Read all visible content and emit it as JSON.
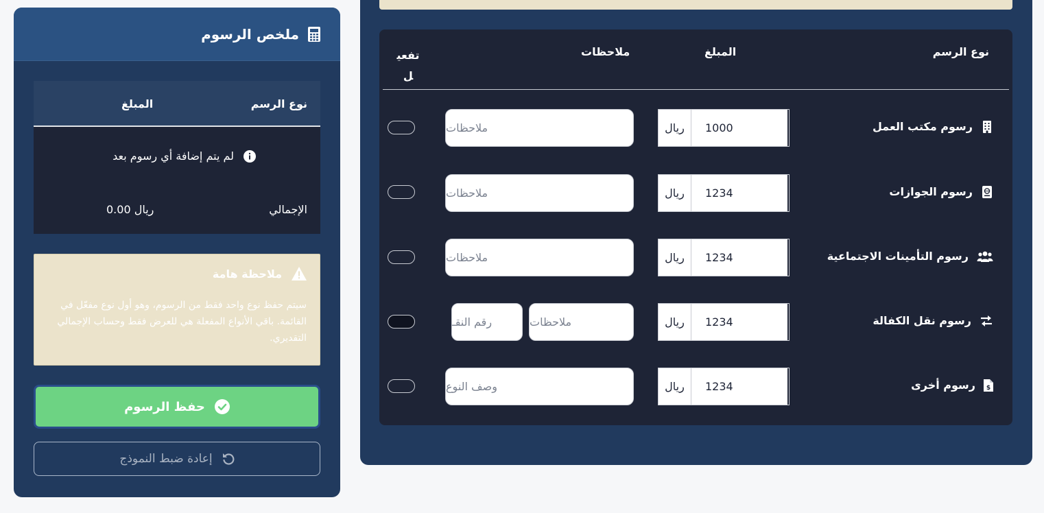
{
  "sidebar": {
    "title": "ملخص الرسوم",
    "summary": {
      "col_type": "نوع الرسم",
      "col_amount": "المبلغ",
      "empty_message": "لم يتم إضافة أي رسوم بعد",
      "total_label": "الإجمالي",
      "total_value": "0.00 ريال"
    },
    "note": {
      "title": "ملاحظة هامة",
      "body": "سيتم حفظ نوع واحد فقط من الرسوم، وهو أول نوع مفعّل في القائمة. باقي الأنواع المفعلة هي للعرض فقط وحساب الإجمالي التقديري."
    },
    "save_label": "حفظ الرسوم",
    "reset_label": "إعادة ضبط النموذج"
  },
  "table": {
    "headers": {
      "type": "نوع الرسم",
      "amount": "المبلغ",
      "notes": "ملاحظات",
      "activate": "تفعيل"
    },
    "rows": [
      {
        "label": "رسوم مكتب العمل",
        "icon": "building-icon",
        "amount": "1000",
        "unit": "ريال",
        "note_placeholder": "ملاحظات"
      },
      {
        "label": "رسوم الجوازات",
        "icon": "passport-icon",
        "amount": "1234",
        "unit": "ريال",
        "note_placeholder": "ملاحظات"
      },
      {
        "label": "رسوم التأمينات الاجتماعية",
        "icon": "users-icon",
        "amount": "1234",
        "unit": "ريال",
        "note_placeholder": "ملاحظات"
      },
      {
        "label": "رسوم نقل الكفالة",
        "icon": "exchange-icon",
        "amount": "1234",
        "unit": "ريال",
        "note_placeholder": "ملاحظات",
        "extra_placeholder": "رقم النقـ"
      },
      {
        "label": "رسوم أخرى",
        "icon": "invoice-icon",
        "amount": "1234",
        "unit": "ريال",
        "note_placeholder": "وصف النوع"
      }
    ]
  },
  "colors": {
    "main_bg": "#213a5e",
    "table_bg": "#1e2436",
    "save_green": "#6dd383",
    "note_bg": "#ebe3cb"
  }
}
